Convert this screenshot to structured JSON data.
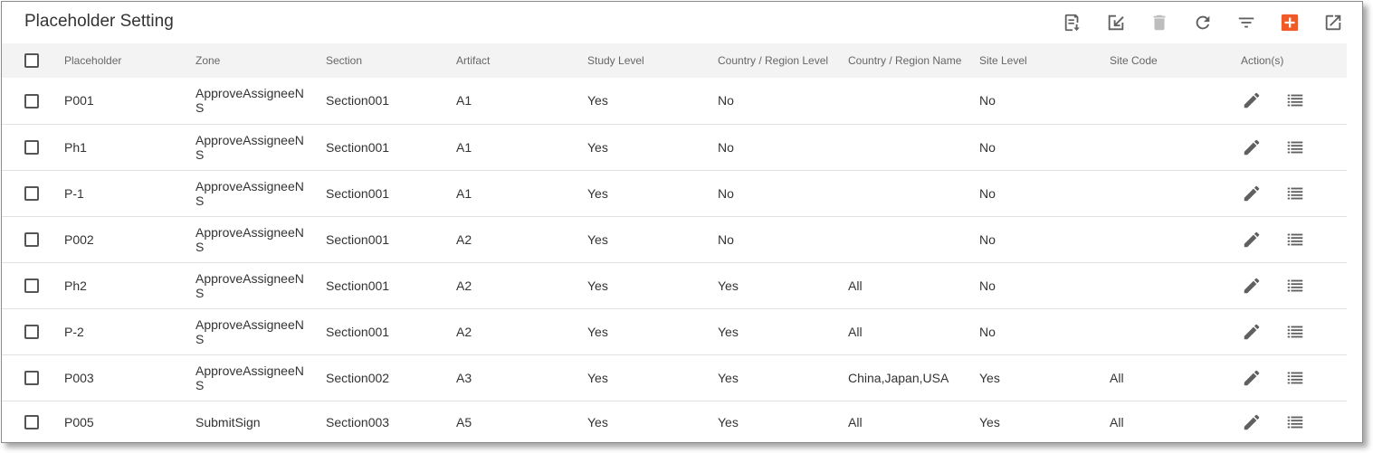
{
  "header": {
    "title": "Placeholder Setting"
  },
  "toolbar": {
    "items": [
      {
        "icon": "export-list-icon"
      },
      {
        "icon": "import-edit-icon"
      },
      {
        "icon": "delete-icon"
      },
      {
        "icon": "refresh-icon"
      },
      {
        "icon": "filter-icon"
      },
      {
        "icon": "add-icon",
        "color": "#f15a24"
      },
      {
        "icon": "open-external-icon"
      }
    ]
  },
  "table": {
    "columns": [
      "Placeholder",
      "Zone",
      "Section",
      "Artifact",
      "Study Level",
      "Country / Region Level",
      "Country / Region Name",
      "Site Level",
      "Site Code",
      "Action(s)"
    ],
    "rows": [
      {
        "placeholder": "P001",
        "zone": "ApproveAssigneeNS",
        "section": "Section001",
        "artifact": "A1",
        "study": "Yes",
        "country_level": "No",
        "country_name": "",
        "site_level": "No",
        "site_code": ""
      },
      {
        "placeholder": "Ph1",
        "zone": "ApproveAssigneeNS",
        "section": "Section001",
        "artifact": "A1",
        "study": "Yes",
        "country_level": "No",
        "country_name": "",
        "site_level": "No",
        "site_code": ""
      },
      {
        "placeholder": "P-1",
        "zone": "ApproveAssigneeNS",
        "section": "Section001",
        "artifact": "A1",
        "study": "Yes",
        "country_level": "No",
        "country_name": "",
        "site_level": "No",
        "site_code": ""
      },
      {
        "placeholder": "P002",
        "zone": "ApproveAssigneeNS",
        "section": "Section001",
        "artifact": "A2",
        "study": "Yes",
        "country_level": "No",
        "country_name": "",
        "site_level": "No",
        "site_code": ""
      },
      {
        "placeholder": "Ph2",
        "zone": "ApproveAssigneeNS",
        "section": "Section001",
        "artifact": "A2",
        "study": "Yes",
        "country_level": "Yes",
        "country_name": "All",
        "site_level": "No",
        "site_code": ""
      },
      {
        "placeholder": "P-2",
        "zone": "ApproveAssigneeNS",
        "section": "Section001",
        "artifact": "A2",
        "study": "Yes",
        "country_level": "Yes",
        "country_name": "All",
        "site_level": "No",
        "site_code": ""
      },
      {
        "placeholder": "P003",
        "zone": "ApproveAssigneeNS",
        "section": "Section002",
        "artifact": "A3",
        "study": "Yes",
        "country_level": "Yes",
        "country_name": "China,Japan,USA",
        "site_level": "Yes",
        "site_code": "All"
      },
      {
        "placeholder": "P005",
        "zone": "SubmitSign",
        "section": "Section003",
        "artifact": "A5",
        "study": "Yes",
        "country_level": "Yes",
        "country_name": "All",
        "site_level": "Yes",
        "site_code": "All"
      }
    ],
    "row_actions": [
      {
        "icon": "edit-pencil-icon"
      },
      {
        "icon": "list-icon"
      }
    ]
  },
  "colors": {
    "accent": "#f15a24",
    "icon": "#606060",
    "icon_disabled": "#bdbdbd",
    "header_bg": "#f3f3f3"
  }
}
